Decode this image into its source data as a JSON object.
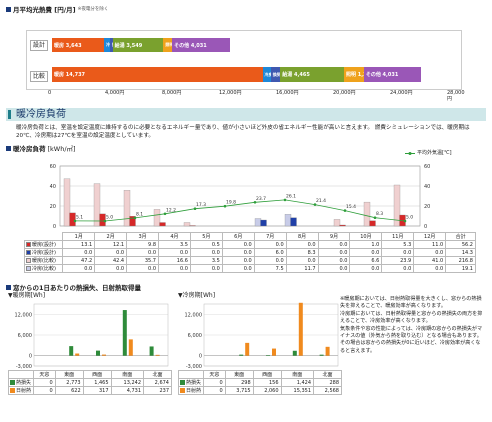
{
  "energy_cost": {
    "title": "月平均光熱費 [円/月]",
    "note": "※夜電分を除く",
    "rows": [
      {
        "label": "設計",
        "segments": [
          {
            "name": "暖房",
            "value": 3643,
            "text": "暖房 3,643",
            "color": "#ea5a1a"
          },
          {
            "name": "冷房",
            "value": 420,
            "text": "冷房 420",
            "color": "#1e88d8"
          },
          {
            "name": "換気",
            "value": 184,
            "text": "換気 184",
            "color": "#3f58b0"
          },
          {
            "name": "給湯",
            "value": 3549,
            "text": "給湯 3,549",
            "color": "#7aa12e"
          },
          {
            "name": "照明",
            "value": 614,
            "text": "照明 614",
            "color": "#efa21c"
          },
          {
            "name": "その他",
            "value": 4031,
            "text": "その他 4,031",
            "color": "#9a57b7"
          }
        ]
      },
      {
        "label": "比較",
        "segments": [
          {
            "name": "暖房",
            "value": 14737,
            "text": "暖房 14,737",
            "color": "#ea5a1a"
          },
          {
            "name": "冷房",
            "value": 572,
            "text": "冷房 572",
            "color": "#1e88d8"
          },
          {
            "name": "換気",
            "value": 670,
            "text": "換気 670",
            "color": "#3f58b0"
          },
          {
            "name": "給湯",
            "value": 4465,
            "text": "給湯 4,465",
            "color": "#7aa12e"
          },
          {
            "name": "照明",
            "value": 1383,
            "text": "照明 1,383",
            "color": "#efa21c"
          },
          {
            "name": "その他",
            "value": 4031,
            "text": "その他 4,031",
            "color": "#9a57b7"
          }
        ]
      }
    ],
    "axis_ticks": [
      "0",
      "4,000円",
      "8,000円",
      "12,000円",
      "16,000円",
      "20,000円",
      "24,000円",
      "28,000円"
    ],
    "axis_max": 28000
  },
  "section_title": "暖冷房負荷",
  "description": "暖冷房負荷とは、室温を設定温度に維持するのに必要となるエネルギー量であり、値が小さいほど外皮の省エネルギー性能が高いと言えます。 燃費シミュレーションでは、暖房期は20℃、冷房期は27℃を室温の設定温度としています。",
  "monthly": {
    "title": "暖冷房負荷",
    "unit": "[kWh/㎡]",
    "legend_temp": "平均外気温[℃]",
    "y_left_ticks": [
      "60",
      "40",
      "20",
      "0"
    ],
    "y_right_ticks": [
      "60",
      "40",
      "20",
      "0"
    ],
    "y_max": 60,
    "months": [
      "1月",
      "2月",
      "3月",
      "4月",
      "5月",
      "6月",
      "7月",
      "8月",
      "9月",
      "10月",
      "11月",
      "12月"
    ],
    "total_label": "合計",
    "temps": [
      "5.1",
      "5.0",
      "8.1",
      "12.2",
      "17.3",
      "19.8",
      "23.7",
      "26.1",
      "21.4",
      "15.4",
      "8.3",
      "5.0"
    ],
    "rows": [
      {
        "label": "暖房(設計)",
        "color": "#d62828",
        "values": [
          "13.1",
          "12.1",
          "9.8",
          "3.5",
          "0.5",
          "0.0",
          "0.0",
          "0.0",
          "0.0",
          "1.0",
          "5.3",
          "11.0",
          "56.2"
        ]
      },
      {
        "label": "冷房(設計)",
        "color": "#2040a8",
        "values": [
          "0.0",
          "0.0",
          "0.0",
          "0.0",
          "0.0",
          "0.0",
          "6.0",
          "8.3",
          "0.0",
          "0.0",
          "0.0",
          "0.0",
          "14.3"
        ]
      },
      {
        "label": "暖房(比較)",
        "color": "#f0d0d0",
        "values": [
          "47.2",
          "42.4",
          "35.7",
          "16.6",
          "3.5",
          "0.0",
          "0.0",
          "0.0",
          "0.0",
          "6.6",
          "23.9",
          "41.0",
          "216.8"
        ]
      },
      {
        "label": "冷房(比較)",
        "color": "#c8cce8",
        "values": [
          "0.0",
          "0.0",
          "0.0",
          "0.0",
          "0.0",
          "0.0",
          "7.5",
          "11.7",
          "0.0",
          "0.0",
          "0.0",
          "0.0",
          "19.1"
        ]
      }
    ]
  },
  "window": {
    "title": "窓からの1日あたりの熱損失、日射熱取得量",
    "left": {
      "title": "▼暖房期[Wh]",
      "y_ticks": [
        "12,000",
        "6,000",
        "0",
        "-3,000"
      ]
    },
    "right": {
      "title": "▼冷房期[Wh]",
      "y_ticks": [
        "12,000",
        "6,000",
        "0",
        "-3,000"
      ]
    },
    "y_min": -3000,
    "y_max": 15000,
    "directions": [
      "天窓",
      "東面",
      "西面",
      "南面",
      "北面"
    ],
    "series_labels": [
      "熱損失",
      "日射熱"
    ],
    "colors": {
      "loss": "#2e8b3a",
      "gain": "#f08a1e"
    },
    "heating": {
      "loss": [
        "0",
        "2,773",
        "1,465",
        "13,242",
        "2,674"
      ],
      "gain": [
        "0",
        "622",
        "317",
        "4,731",
        "237"
      ]
    },
    "cooling": {
      "loss": [
        "0",
        "298",
        "156",
        "1,424",
        "288"
      ],
      "gain": [
        "0",
        "3,715",
        "2,060",
        "15,351",
        "2,568"
      ]
    },
    "heating_values": {
      "loss": [
        0,
        2773,
        1465,
        13242,
        2674
      ],
      "gain": [
        0,
        622,
        317,
        4731,
        237
      ]
    },
    "cooling_values": {
      "loss": [
        0,
        298,
        156,
        1424,
        288
      ],
      "gain": [
        0,
        3715,
        2060,
        15351,
        2568
      ]
    },
    "notes": [
      "※暖房期においては、日射熱取得量を大きくし、窓からの熱損失を抑えることで、暖房効率が高くなります。",
      "冷房期においては、日射熱取得量と窓からの熱損失の両方を抑えることで、冷房効率が高くなります。",
      "気象条件や窓の性能によっては、冷房期の窓からの熱損失がマイナスの値（外気から熱を取り込む）となる場合もあります。",
      "その場合は窓からの熱損失が0に近いほど、冷房効率が高くなると言えます。"
    ]
  }
}
